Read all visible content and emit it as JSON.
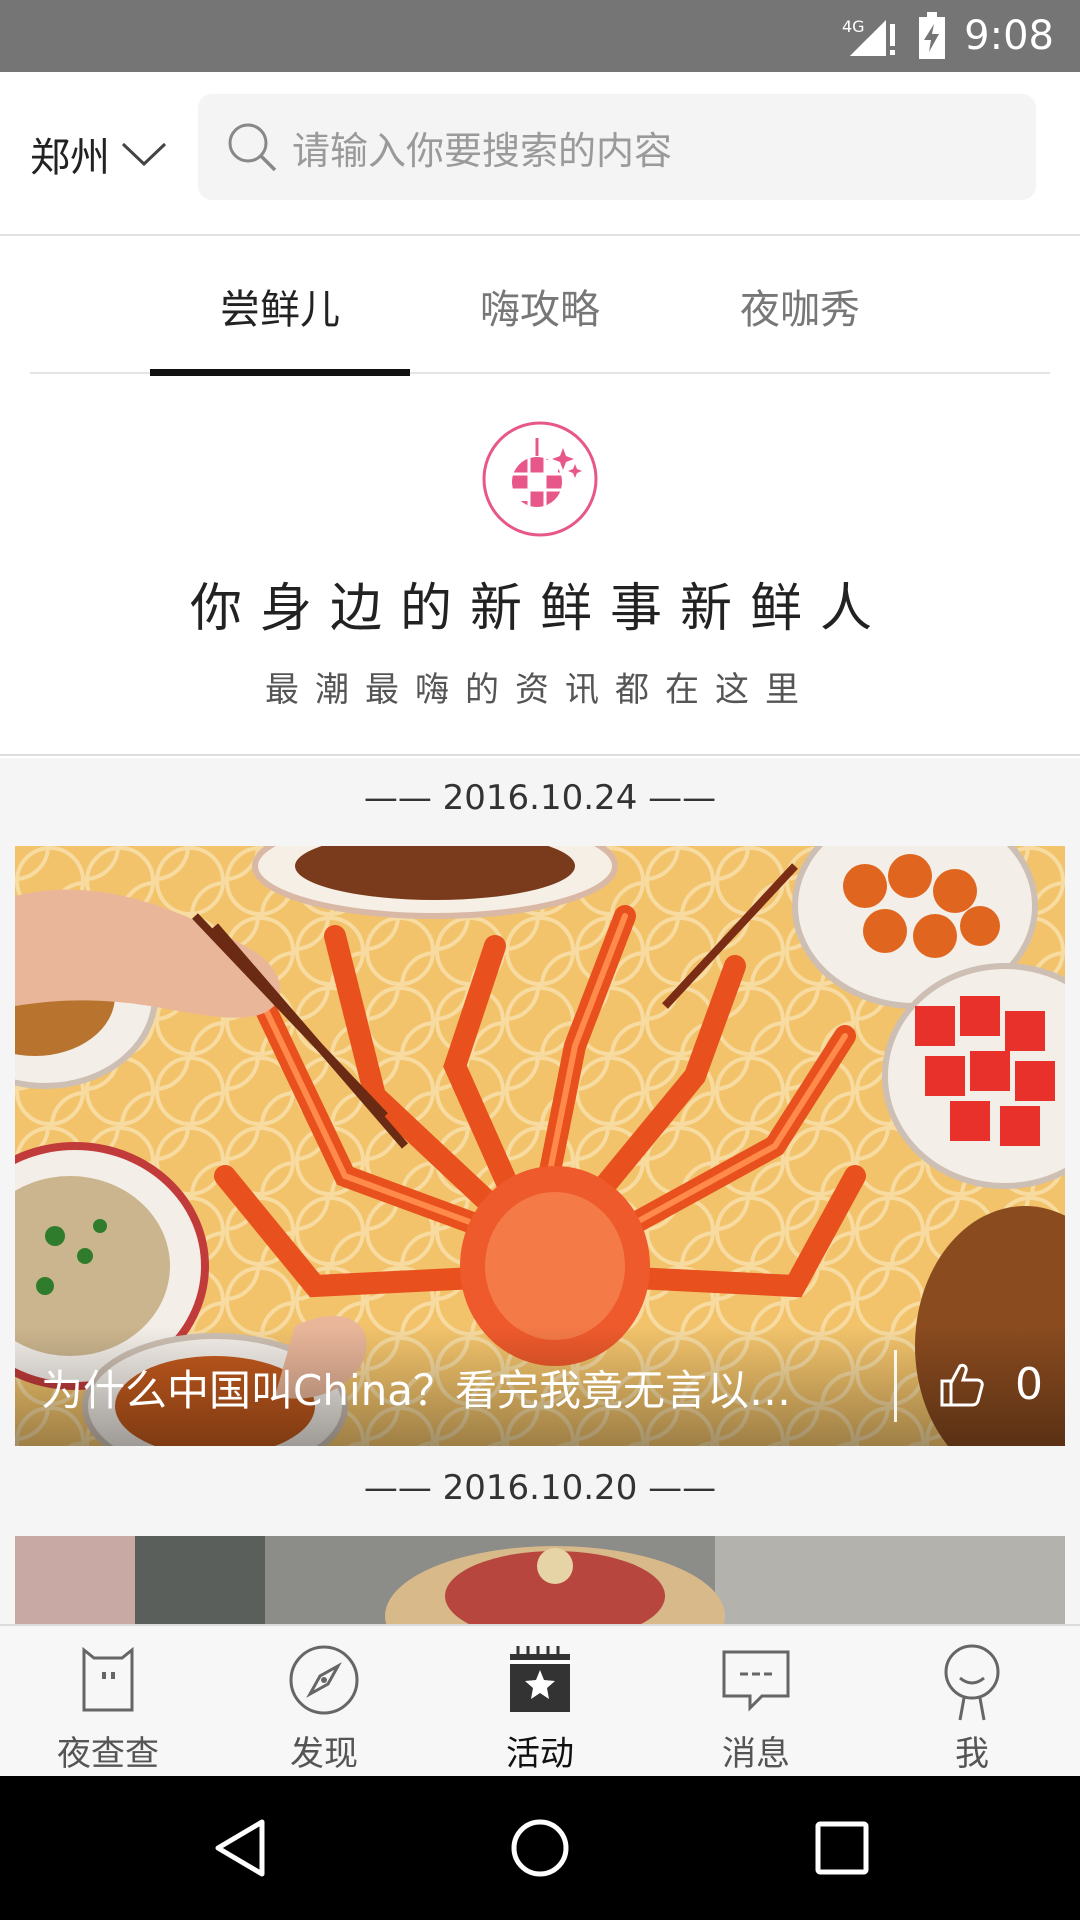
{
  "status_bar": {
    "network": "4G",
    "time": "9:08"
  },
  "header": {
    "city": "郑州",
    "search_placeholder": "请输入你要搜索的内容"
  },
  "tabs": [
    {
      "label": "尝鲜儿",
      "active": true
    },
    {
      "label": "嗨攻略",
      "active": false
    },
    {
      "label": "夜咖秀",
      "active": false
    }
  ],
  "banner": {
    "icon": "disco-ball-icon",
    "title": "你身边的新鲜事新鲜人",
    "subtitle": "最潮最嗨的资讯都在这里"
  },
  "feed": [
    {
      "date": "—— 2016.10.24 ——",
      "title": "为什么中国叫China？看完我竟无言以…",
      "likes": "0"
    },
    {
      "date": "—— 2016.10.20 ——"
    }
  ],
  "bottom_nav": [
    {
      "label": "夜查查",
      "icon": "owl-icon",
      "active": false
    },
    {
      "label": "发现",
      "icon": "compass-icon",
      "active": false
    },
    {
      "label": "活动",
      "icon": "calendar-star-icon",
      "active": true
    },
    {
      "label": "消息",
      "icon": "message-icon",
      "active": false
    },
    {
      "label": "我",
      "icon": "profile-icon",
      "active": false
    }
  ],
  "colors": {
    "accent_pink": "#e8578a",
    "active_tab": "#111111",
    "status_bar": "#757575"
  }
}
